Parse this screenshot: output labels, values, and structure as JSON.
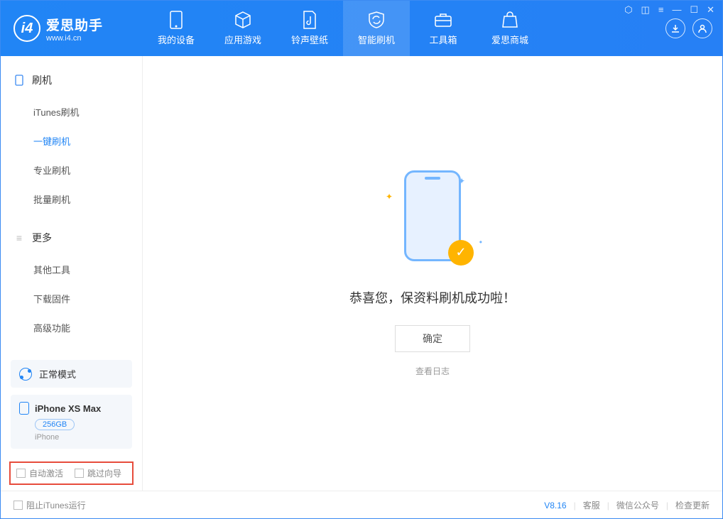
{
  "app": {
    "title": "爱思助手",
    "subtitle": "www.i4.cn"
  },
  "nav": [
    {
      "label": "我的设备"
    },
    {
      "label": "应用游戏"
    },
    {
      "label": "铃声壁纸"
    },
    {
      "label": "智能刷机"
    },
    {
      "label": "工具箱"
    },
    {
      "label": "爱思商城"
    }
  ],
  "sidebar": {
    "section1": {
      "title": "刷机",
      "items": [
        "iTunes刷机",
        "一键刷机",
        "专业刷机",
        "批量刷机"
      ]
    },
    "section2": {
      "title": "更多",
      "items": [
        "其他工具",
        "下载固件",
        "高级功能"
      ]
    }
  },
  "device": {
    "mode": "正常模式",
    "name": "iPhone XS Max",
    "storage": "256GB",
    "type": "iPhone"
  },
  "options": {
    "opt1": "自动激活",
    "opt2": "跳过向导"
  },
  "main": {
    "message": "恭喜您，保资料刷机成功啦！",
    "confirm": "确定",
    "log_link": "查看日志"
  },
  "footer": {
    "block_itunes": "阻止iTunes运行",
    "version": "V8.16",
    "links": [
      "客服",
      "微信公众号",
      "检查更新"
    ]
  }
}
